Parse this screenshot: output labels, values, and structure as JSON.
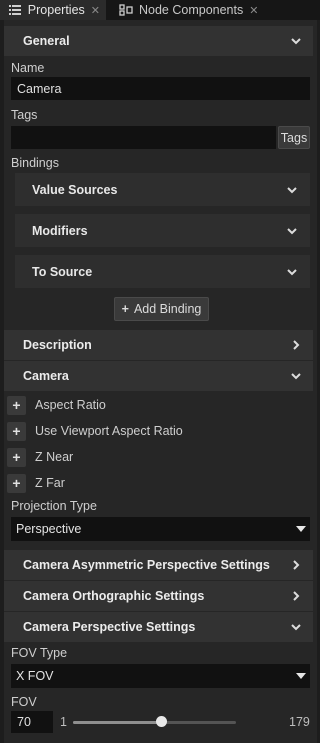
{
  "tabs": [
    {
      "label": "Properties",
      "icon": "list-icon",
      "close": "✕",
      "active": true
    },
    {
      "label": "Node Components",
      "icon": "components-icon",
      "close": "✕",
      "active": false
    }
  ],
  "sections": {
    "general": "General",
    "description": "Description",
    "camera": "Camera",
    "asymmetric": "Camera Asymmetric Perspective Settings",
    "orthographic": "Camera Orthographic Settings",
    "perspective": "Camera Perspective Settings"
  },
  "general": {
    "name_label": "Name",
    "name_value": "Camera",
    "tags_label": "Tags",
    "tags_value": "",
    "tags_button": "Tags",
    "bindings_label": "Bindings",
    "bindings": [
      "Value Sources",
      "Modifiers",
      "To Source"
    ],
    "add_binding": "Add Binding"
  },
  "camera": {
    "add_props": [
      "Aspect Ratio",
      "Use Viewport Aspect Ratio",
      "Z Near",
      "Z Far"
    ],
    "projection_label": "Projection Type",
    "projection_value": "Perspective"
  },
  "perspective": {
    "fov_type_label": "FOV Type",
    "fov_type_value": "X FOV",
    "fov_label": "FOV",
    "fov_value": "70",
    "fov_min": "1",
    "fov_max": "179",
    "fov_fraction": 0.5455
  },
  "colors": {
    "background": "#1d1d1d",
    "panel": "#262626",
    "section": "#323232",
    "input": "#111111"
  }
}
